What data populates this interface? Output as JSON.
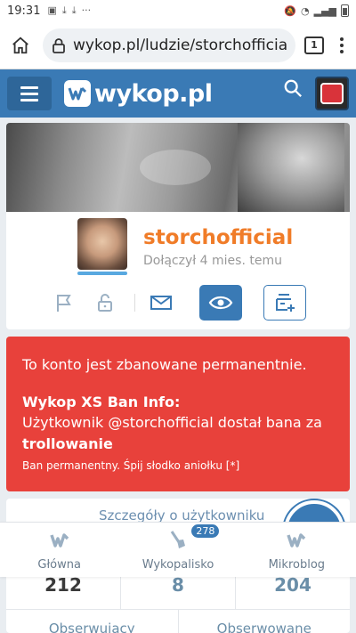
{
  "statusbar": {
    "time": "19:31",
    "dots": "···"
  },
  "browser": {
    "url": "wykop.pl/ludzie/storchofficial",
    "tabs_count": "1"
  },
  "site": {
    "logo_text": "wykop.pl"
  },
  "profile": {
    "username": "storchofficial",
    "joined": "Dołączył 4 mies. temu"
  },
  "ban": {
    "title": "To konto jest zbanowane permanentnie.",
    "info_title": "Wykop XS Ban Info:",
    "message_prefix": "Użytkownik @storchofficial dostał bana za",
    "reason": "trollowanie",
    "note": "Ban permanentny. Śpij słodko aniołku [*]"
  },
  "details": {
    "title": "Szczegóły o użytkowniku",
    "stats": [
      "212",
      "8",
      "204"
    ],
    "tabs": [
      "Obserwujący",
      "Obserwowane"
    ]
  },
  "bottom_nav": {
    "items": [
      {
        "label": "Główna",
        "icon": "main-icon"
      },
      {
        "label": "Wykopalisko",
        "icon": "shovel-icon",
        "badge": "278"
      },
      {
        "label": "Mikroblog",
        "icon": "microblog-icon"
      }
    ]
  },
  "colors": {
    "brand_blue": "#3a7ab5",
    "username_orange": "#f07c28",
    "ban_red": "#e8413b"
  }
}
